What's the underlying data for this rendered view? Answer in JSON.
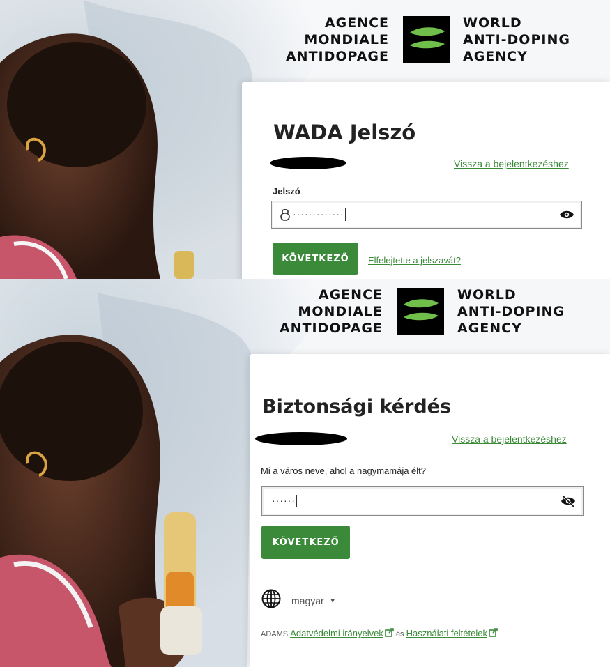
{
  "logo": {
    "fr_lines": [
      "AGENCE",
      "MONDIALE",
      "ANTIDOPAGE"
    ],
    "en_lines": [
      "WORLD",
      "ANTI-DOPING",
      "AGENCY"
    ]
  },
  "password_screen": {
    "title": "WADA Jelszó",
    "back_link": "Vissza a bejelentkezéshez",
    "password_label": "Jelszó",
    "password_value": "·············",
    "next_button": "KÖVETKEZŐ",
    "forgot_link": "Elfelejtette a jelszavát?"
  },
  "security_screen": {
    "title": "Biztonsági kérdés",
    "back_link": "Vissza a bejelentkezéshez",
    "question": "Mi a város neve, ahol a nagymamája élt?",
    "answer_value": "······",
    "next_button": "KÖVETKEZŐ",
    "language": "magyar",
    "footer_prefix": "ADAMS",
    "privacy_link": "Adatvédelmi irányelvek",
    "footer_and": "és",
    "terms_link": "Használati feltételek"
  },
  "colors": {
    "accent": "#3b8a3a",
    "logo_leaf": "#6fbf4a"
  }
}
